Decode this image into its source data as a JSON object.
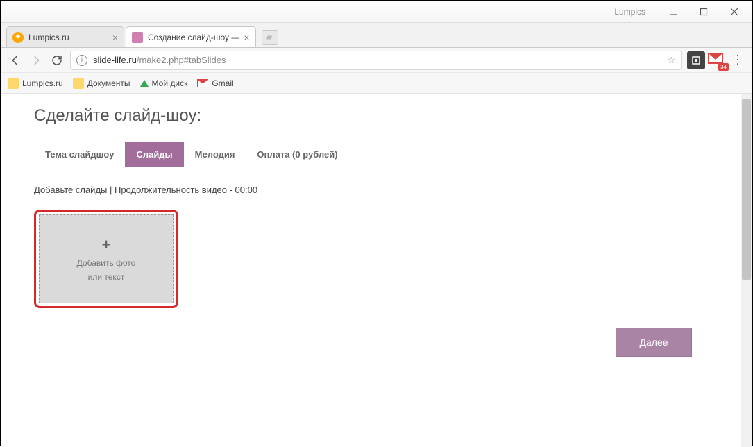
{
  "window": {
    "title": "Lumpics"
  },
  "browser_tabs": [
    {
      "label": "Lumpics.ru"
    },
    {
      "label": "Создание слайд-шоу —"
    }
  ],
  "url": {
    "domain": "slide-life.ru",
    "path": "/make2.php#tabSlides"
  },
  "gmail_badge": "34",
  "bookmarks": [
    {
      "label": "Lumpics.ru"
    },
    {
      "label": "Документы"
    },
    {
      "label": "Мой диск"
    },
    {
      "label": "Gmail"
    }
  ],
  "page": {
    "heading": "Сделайте слайд-шоу:",
    "tabs": [
      {
        "label": "Тема слайдшоу"
      },
      {
        "label": "Слайды"
      },
      {
        "label": "Мелодия"
      },
      {
        "label": "Оплата (0 рублей)"
      }
    ],
    "subheading": "Добавьте слайды | Продолжительность видео - 00:00",
    "add_slide": {
      "plus": "+",
      "line1": "Добавить фото",
      "line2": "или текст"
    },
    "next_label": "Далее"
  }
}
